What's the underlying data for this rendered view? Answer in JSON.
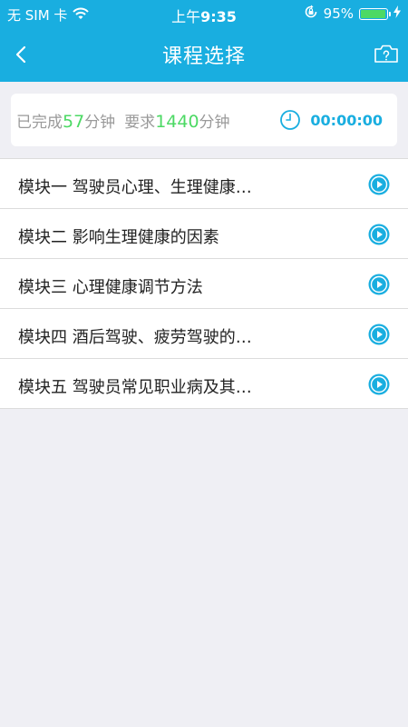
{
  "status_bar": {
    "carrier": "无 SIM 卡",
    "time_prefix": "上午",
    "time": "9:35",
    "battery": "95%",
    "battery_level": 0.95
  },
  "nav": {
    "title": "课程选择"
  },
  "progress": {
    "completed_prefix": "已完成",
    "completed_value": "57",
    "completed_unit": "分钟",
    "required_prefix": "要求",
    "required_value": "1440",
    "required_unit": "分钟",
    "timer": "00:00:00"
  },
  "modules": [
    {
      "label": "模块一 驾驶员心理、生理健康…"
    },
    {
      "label": "模块二 影响生理健康的因素"
    },
    {
      "label": "模块三 心理健康调节方法"
    },
    {
      "label": "模块四 酒后驾驶、疲劳驾驶的…"
    },
    {
      "label": "模块五 驾驶员常见职业病及其…"
    }
  ],
  "colors": {
    "header": "#19aee0",
    "accent_green": "#4cd964",
    "background": "#efeff4"
  },
  "icons": {
    "back": "chevron-left-icon",
    "camera": "camera-help-icon",
    "timer": "clock-icon",
    "play": "play-circle-icon"
  }
}
